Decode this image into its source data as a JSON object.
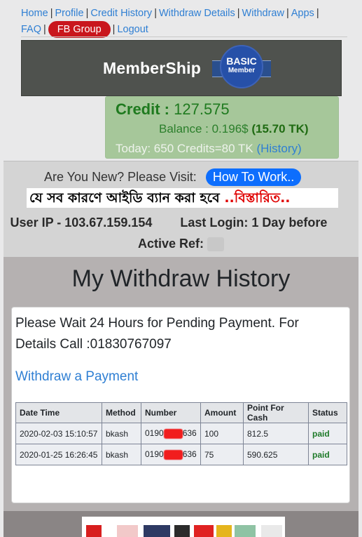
{
  "nav": {
    "items": [
      "Home",
      "Profile",
      "Credit History",
      "Withdraw Details",
      "Withdraw",
      "Apps",
      "FAQ",
      "FB Group",
      "Logout"
    ]
  },
  "banner": {
    "title": "MemberShip",
    "badge_line1": "BASIC",
    "badge_line2": "Member"
  },
  "credit": {
    "label": "Credit :",
    "value": "127.575",
    "balance_label": "Balance : 0.196$",
    "balance_tk": "(15.70 TK)",
    "today": "Today: 650 Credits=80 TK",
    "history_link": "(History)"
  },
  "info": {
    "new_text": "Are You New? Please Visit:",
    "howto_button": "How To Work..",
    "notice_bn": "যে সব কারণে আইডি ব্যান করা হবে",
    "notice_bn_link": "..বিস্তারিত..",
    "ip_label": "User IP - 103.67.159.154",
    "last_login": "Last Login: 1 Day before",
    "active_ref_label": "Active Ref:"
  },
  "withdraw": {
    "heading": "My Withdraw History",
    "message": "Please Wait 24 Hours for Pending Payment. For Details Call :01830767097",
    "link": "Withdraw a Payment",
    "columns": [
      "Date Time",
      "Method",
      "Number",
      "Amount",
      "Point For Cash",
      "Status"
    ],
    "rows": [
      {
        "date": "2020-02-03 15:10:57",
        "method": "bkash",
        "num_a": "0190",
        "num_b": "636",
        "amount": "100",
        "points": "812.5",
        "status": "paid"
      },
      {
        "date": "2020-01-25 16:26:45",
        "method": "bkash",
        "num_a": "0190",
        "num_b": "636",
        "amount": "75",
        "points": "590.625",
        "status": "paid"
      }
    ]
  },
  "colors": {
    "link": "#2f7fd3",
    "fb_button": "#c9161d",
    "credit_green": "#1f7a1f",
    "paid": "#1e7a29",
    "howto_button": "#0d6efd"
  }
}
